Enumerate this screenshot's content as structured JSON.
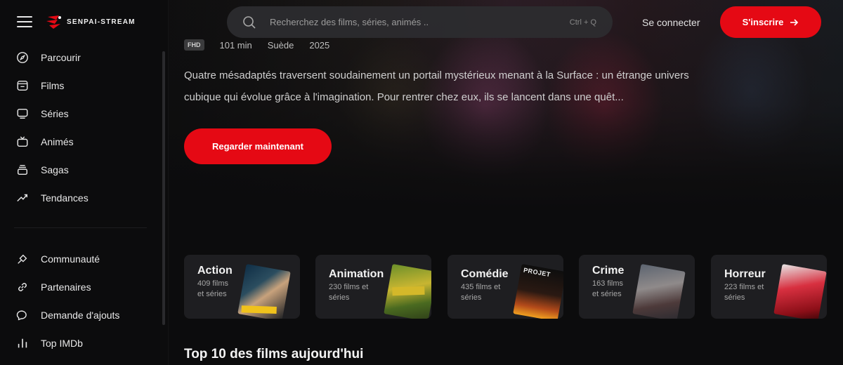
{
  "brand": {
    "name": "SENPAI-STREAM",
    "accent": "#e50914"
  },
  "header": {
    "search_placeholder": "Recherchez des films, séries, animés ..",
    "search_shortcut": "Ctrl + Q",
    "login_label": "Se connecter",
    "signup_label": "S'inscrire",
    "search_icon": "search-icon",
    "signup_icon": "arrow-right-icon"
  },
  "sidebar": {
    "main": [
      {
        "label": "Parcourir",
        "icon": "compass-icon"
      },
      {
        "label": "Films",
        "icon": "film-icon"
      },
      {
        "label": "Séries",
        "icon": "tv-icon"
      },
      {
        "label": "Animés",
        "icon": "retro-tv-icon"
      },
      {
        "label": "Sagas",
        "icon": "stack-icon"
      },
      {
        "label": "Tendances",
        "icon": "trending-icon"
      }
    ],
    "secondary": [
      {
        "label": "Communauté",
        "icon": "handshake-icon"
      },
      {
        "label": "Partenaires",
        "icon": "link-icon"
      },
      {
        "label": "Demande d'ajouts",
        "icon": "chat-icon"
      },
      {
        "label": "Top IMDb",
        "icon": "bar-chart-icon"
      }
    ]
  },
  "hero": {
    "quality": "FHD",
    "duration": "101 min",
    "country": "Suède",
    "year": "2025",
    "synopsis": "Quatre mésadaptés traversent soudainement un portail mystérieux menant à la Surface : un étrange univers cubique qui évolue grâce à l'imagination. Pour rentrer chez eux, ils se lancent dans une quêt...",
    "watch_label": "Regarder maintenant"
  },
  "categories": [
    {
      "name": "Action",
      "count": "409 films et séries",
      "poster_title": ""
    },
    {
      "name": "Animation",
      "count": "230 films et séries",
      "poster_title": ""
    },
    {
      "name": "Comédie",
      "count": "435 films et séries",
      "poster_title": "PROJET"
    },
    {
      "name": "Crime",
      "count": "163 films et séries",
      "poster_title": ""
    },
    {
      "name": "Horreur",
      "count": "223 films et séries",
      "poster_title": ""
    }
  ],
  "sections": {
    "top10_title": "Top 10 des films aujourd'hui"
  }
}
